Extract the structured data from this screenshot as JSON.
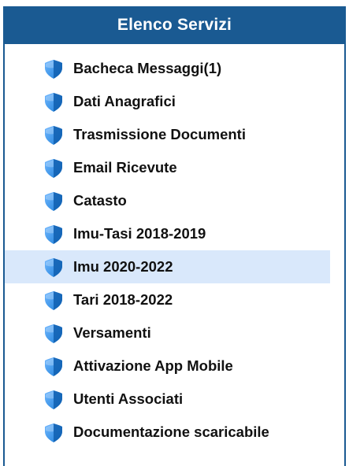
{
  "panel": {
    "title": "Elenco Servizi",
    "colors": {
      "header_bg": "#1a5a92",
      "header_text": "#ffffff",
      "highlight_bg": "#d9e8fb",
      "icon_blue": "#1f7fd8"
    },
    "items": [
      {
        "label": "Bacheca Messaggi(1)",
        "icon": "blue-shield-icon"
      },
      {
        "label": "Dati Anagrafici",
        "icon": "blue-shield-icon"
      },
      {
        "label": "Trasmissione Documenti",
        "icon": "blue-shield-icon"
      },
      {
        "label": "Email Ricevute",
        "icon": "blue-shield-icon"
      },
      {
        "label": "Catasto",
        "icon": "blue-shield-icon"
      },
      {
        "label": "Imu-Tasi 2018-2019",
        "icon": "blue-shield-icon"
      },
      {
        "label": "Imu 2020-2022",
        "icon": "blue-shield-icon",
        "highlighted": true
      },
      {
        "label": "Tari 2018-2022",
        "icon": "blue-shield-icon"
      },
      {
        "label": "Versamenti",
        "icon": "blue-shield-icon"
      },
      {
        "label": "Attivazione App Mobile",
        "icon": "blue-shield-icon"
      },
      {
        "label": "Utenti Associati",
        "icon": "blue-shield-icon"
      },
      {
        "label": "Documentazione scaricabile",
        "icon": "blue-shield-icon"
      }
    ]
  }
}
